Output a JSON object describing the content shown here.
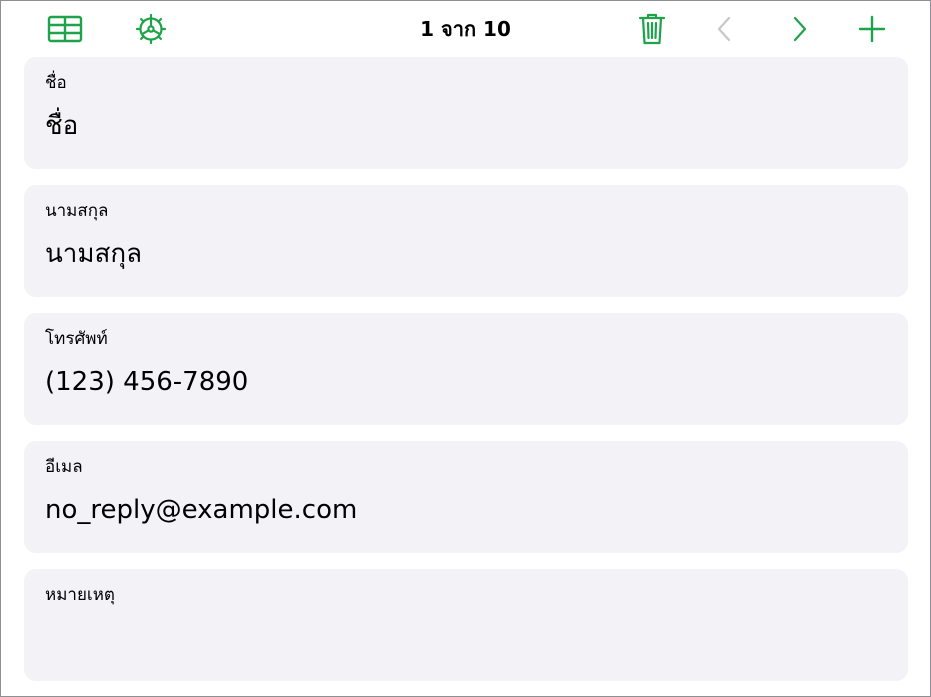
{
  "colors": {
    "accent": "#1fa34a",
    "disabled": "#c7c7cc",
    "card_background": "#f2f2f7"
  },
  "toolbar": {
    "table_view_icon": "table-grid-icon",
    "settings_icon": "gear-icon",
    "record_counter": "1 จาก 10",
    "delete_icon": "trash-icon",
    "previous_icon": "chevron-left-icon",
    "next_icon": "chevron-right-icon",
    "add_icon": "plus-icon"
  },
  "fields": [
    {
      "label": "ชื่อ",
      "value": "ชื่อ"
    },
    {
      "label": "นามสกุล",
      "value": "นามสกุล"
    },
    {
      "label": "โทรศัพท์",
      "value": "(123) 456-7890"
    },
    {
      "label": "อีเมล",
      "value": "no_reply@example.com"
    },
    {
      "label": "หมายเหตุ",
      "value": ""
    }
  ]
}
